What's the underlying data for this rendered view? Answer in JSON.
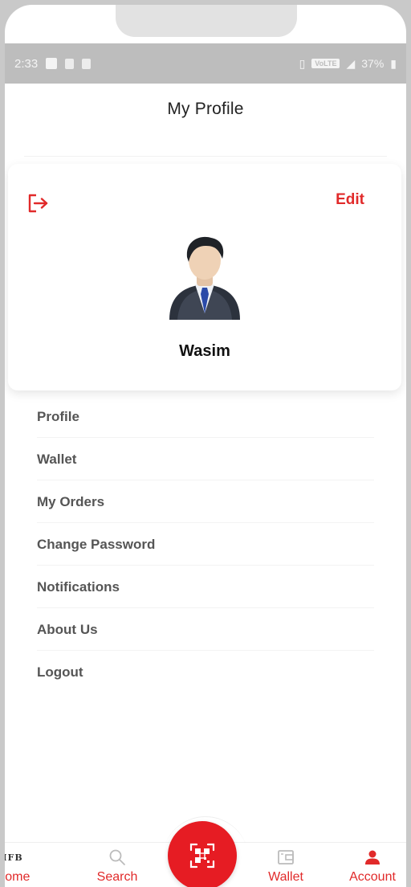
{
  "status_bar": {
    "time": "2:33",
    "volte": "VoLTE",
    "battery": "37%"
  },
  "header": {
    "title": "My Profile"
  },
  "profile": {
    "edit_label": "Edit",
    "name": "Wasim"
  },
  "menu": {
    "items": [
      {
        "label": "Profile"
      },
      {
        "label": "Wallet"
      },
      {
        "label": "My Orders"
      },
      {
        "label": "Change Password"
      },
      {
        "label": "Notifications"
      },
      {
        "label": "About Us"
      },
      {
        "label": "Logout"
      }
    ]
  },
  "bottom_nav": {
    "home_logo": "IFB",
    "home_label": "Home",
    "search_label": "Search",
    "wallet_label": "Wallet",
    "account_label": "Account"
  },
  "colors": {
    "accent": "#e12a2a",
    "fab": "#e61c23",
    "status_bar": "#bdbdbd"
  },
  "icons": [
    "logout-icon",
    "qr-scan-icon",
    "search-icon",
    "wallet-icon",
    "person-icon"
  ]
}
